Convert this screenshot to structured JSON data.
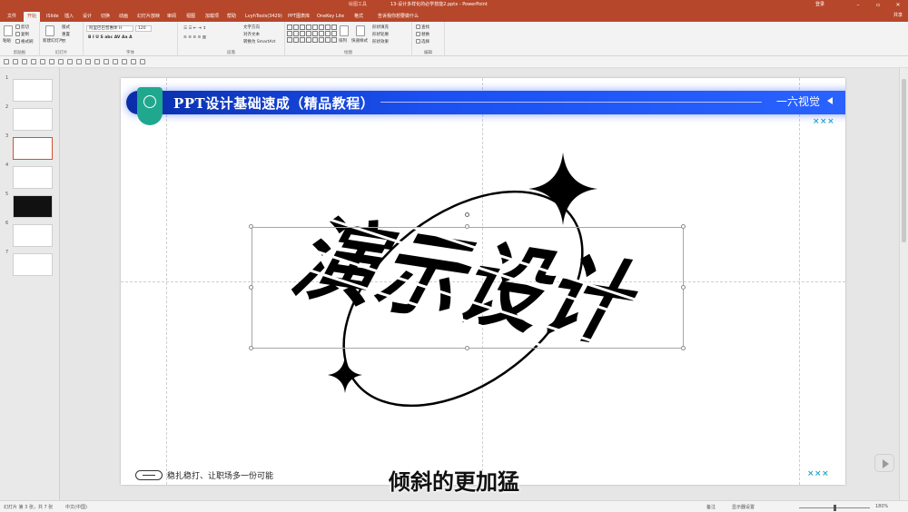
{
  "app": {
    "context_tab": "绘图工具",
    "document_title": "13-设计多样化的必学技能2.pptx  -  PowerPoint",
    "login_label": "登录",
    "share_label": "共享",
    "window_controls": [
      "minimize-icon",
      "restore-icon",
      "close-icon"
    ]
  },
  "menu_tabs": [
    "文件",
    "开始",
    "iSlide",
    "插入",
    "设计",
    "切换",
    "动画",
    "幻灯片放映",
    "审阅",
    "视图",
    "加载项",
    "帮助",
    "LvyhTools(3429)",
    "PPT图表库",
    "OneKey Lite",
    "格式",
    "告诉我你想要做什么"
  ],
  "active_tab": "开始",
  "ribbon": {
    "clipboard": {
      "label": "剪贴板",
      "paste": "粘贴",
      "cut": "剪切",
      "copy": "复制",
      "format_painter": "格式刷"
    },
    "slides": {
      "label": "幻灯片",
      "new_slide": "新建幻灯片",
      "layout": "版式",
      "reset": "重置",
      "section": "节"
    },
    "font": {
      "label": "字体",
      "font_name": "阿里巴巴普惠体 H",
      "font_size": "120"
    },
    "paragraph": {
      "label": "段落",
      "text_direction": "文字方向",
      "align_text": "对齐文本",
      "smartart": "转换为 SmartArt"
    },
    "drawing": {
      "label": "绘图",
      "arrange": "排列",
      "quick_styles": "快速样式",
      "fill": "形状填充",
      "outline": "形状轮廓",
      "effects": "形状效果"
    },
    "editing": {
      "label": "编辑",
      "find": "查找",
      "replace": "替换",
      "select": "选择"
    }
  },
  "thumbnails": [
    {
      "num": "1",
      "style": "light"
    },
    {
      "num": "2",
      "style": "light"
    },
    {
      "num": "3",
      "style": "selected"
    },
    {
      "num": "4",
      "style": "light"
    },
    {
      "num": "5",
      "style": "dark"
    },
    {
      "num": "6",
      "style": "light"
    },
    {
      "num": "7",
      "style": "light"
    }
  ],
  "slide": {
    "banner_title": "PPT设计基础速成（精品教程）",
    "banner_right": "一六视觉",
    "xxx_mark": "×××",
    "wordart": "演示设计",
    "footer_text": "稳扎稳打、让职场多一份可能"
  },
  "subtitle": "倾斜的更加猛",
  "status": {
    "slide_info": "幻灯片 第 3 张，共 7 张",
    "language": "中文(中国)",
    "notes": "备注",
    "comments": "显示器设置",
    "zoom": "180%"
  },
  "colors": {
    "ribbon_brand": "#b7472a",
    "banner_blue": "#1b4ff0",
    "teal_icon": "#20a88f",
    "xxx_teal": "#27a6c7"
  }
}
